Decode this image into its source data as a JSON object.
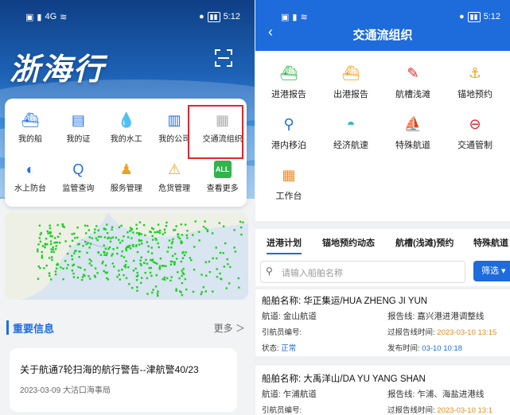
{
  "left": {
    "statusbar": {
      "time": "5:12",
      "signal_text": "4G"
    },
    "brand": "浙海行",
    "menu": [
      {
        "label": "我的船",
        "icon": "ship-icon",
        "color": "#1f6fe0"
      },
      {
        "label": "我的证",
        "icon": "certificate-icon",
        "color": "#1f6fe0"
      },
      {
        "label": "我的水工",
        "icon": "water-engineering-icon",
        "color": "#1f6fe0"
      },
      {
        "label": "我的公司",
        "icon": "company-icon",
        "color": "#1f6fe0"
      },
      {
        "label": "交通流组织",
        "icon": "traffic-flow-icon",
        "color": "#b0b0b0"
      },
      {
        "label": "水上防台",
        "icon": "typhoon-defense-icon",
        "color": "#1f6fe0"
      },
      {
        "label": "监管查询",
        "icon": "query-icon",
        "color": "#1f6fe0"
      },
      {
        "label": "服务管理",
        "icon": "service-icon",
        "color": "#f0a020"
      },
      {
        "label": "危货管理",
        "icon": "hazard-icon",
        "color": "#f0a020"
      },
      {
        "label": "查看更多",
        "icon": "all-icon",
        "color": "#31b44b"
      }
    ],
    "news_header": "重要信息",
    "news_more": "更多 ＞",
    "news": {
      "title": "关于航通7轮扫海的航行警告--津航警40/23",
      "date": "2023-03-09",
      "source": "大沽口海事局"
    }
  },
  "right": {
    "statusbar": {
      "time": "5:12"
    },
    "title": "交通流组织",
    "menu": [
      {
        "label": "进港报告",
        "icon": "inbound-report-icon",
        "color": "#31b44b"
      },
      {
        "label": "出港报告",
        "icon": "outbound-report-icon",
        "color": "#f0a020"
      },
      {
        "label": "航槽浅滩",
        "icon": "channel-shoal-icon",
        "color": "#e0262b"
      },
      {
        "label": "锚地预约",
        "icon": "anchor-icon",
        "color": "#f0a020"
      },
      {
        "label": "港内移泊",
        "icon": "berth-shift-icon",
        "color": "#1f6fe0"
      },
      {
        "label": "经济航速",
        "icon": "speed-gauge-icon",
        "color": "#31b4c4"
      },
      {
        "label": "特殊航道",
        "icon": "special-channel-icon",
        "color": "#31b44b"
      },
      {
        "label": "交通管制",
        "icon": "no-entry-icon",
        "color": "#e0262b"
      },
      {
        "label": "工作台",
        "icon": "workbench-icon",
        "color": "#f08a20"
      }
    ],
    "tabs": [
      "进港计划",
      "锚地预约动态",
      "航槽(浅滩)预约",
      "特殊航道"
    ],
    "search_placeholder": "请输入船舶名称",
    "filter_label": "筛选",
    "records": [
      {
        "ship_label": "船舶名称:",
        "ship": "华正集运/HUA ZHENG JI YUN",
        "route_label": "航道:",
        "route": "金山航道",
        "report_label": "报告线:",
        "report": "嘉兴港进港调整线",
        "pilot_label": "引航员编号:",
        "pilot": "",
        "report_time_label": "过报告线时间:",
        "report_time": "2023-03-10 13:15",
        "status_label": "状态:",
        "status": "正常",
        "publish_label": "发布时间:",
        "publish": "03-10 10:18"
      },
      {
        "ship_label": "船舶名称:",
        "ship": "大禹洋山/DA YU YANG SHAN",
        "route_label": "航道:",
        "route": "乍浦航道",
        "report_label": "报告线:",
        "report": "乍浦、海盐进港线",
        "pilot_label": "引航员编号:",
        "pilot": "",
        "report_time_label": "过报告线时间:",
        "report_time": "2023-03-10 13:1",
        "status_label": "",
        "status": "",
        "publish_label": "",
        "publish": ""
      }
    ]
  }
}
